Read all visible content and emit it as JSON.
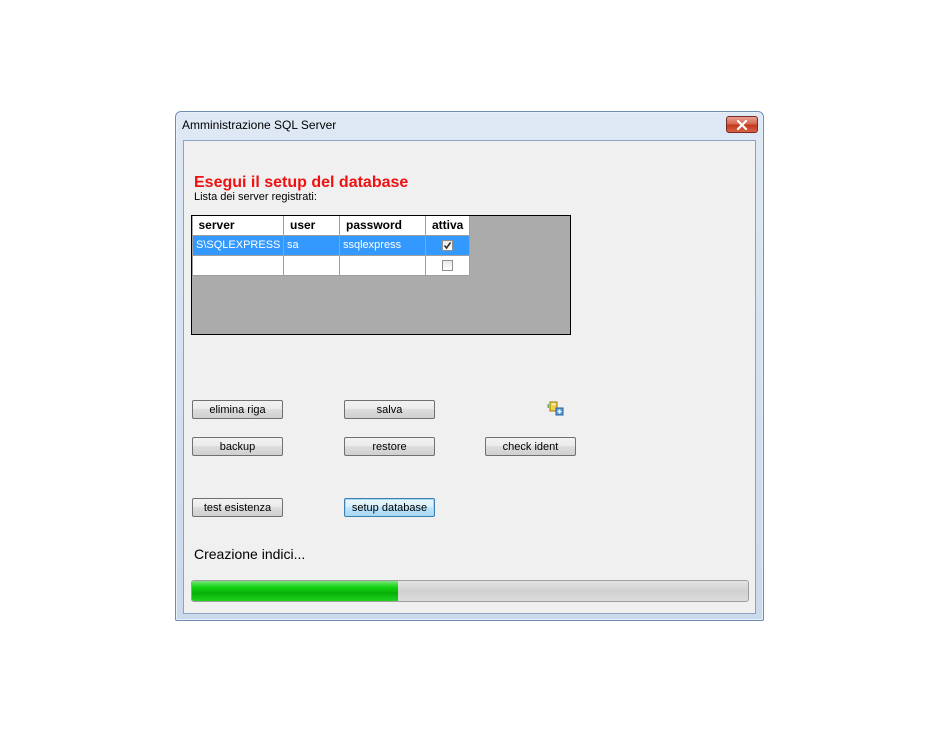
{
  "window": {
    "title": "Amministrazione SQL Server"
  },
  "heading": "Esegui il setup del database",
  "subheading": "Lista dei server registrati:",
  "grid": {
    "columns": [
      "server",
      "user",
      "password",
      "attiva"
    ],
    "rows": [
      {
        "server": "S\\SQLEXPRESS",
        "user": "sa",
        "password": "ssqlexpress",
        "attiva": true,
        "selected": true
      },
      {
        "server": "",
        "user": "",
        "password": "",
        "attiva": false,
        "selected": false
      }
    ]
  },
  "buttons": {
    "elimina_riga": "elimina riga",
    "salva": "salva",
    "backup": "backup",
    "restore": "restore",
    "check_ident": "check ident",
    "test_esistenza": "test esistenza",
    "setup_database": "setup database"
  },
  "icons": {
    "close": "close-icon",
    "tool": "add-connection-icon"
  },
  "status_text": "Creazione indici...",
  "progress": {
    "fraction": 0.37,
    "color": "#06b006"
  }
}
